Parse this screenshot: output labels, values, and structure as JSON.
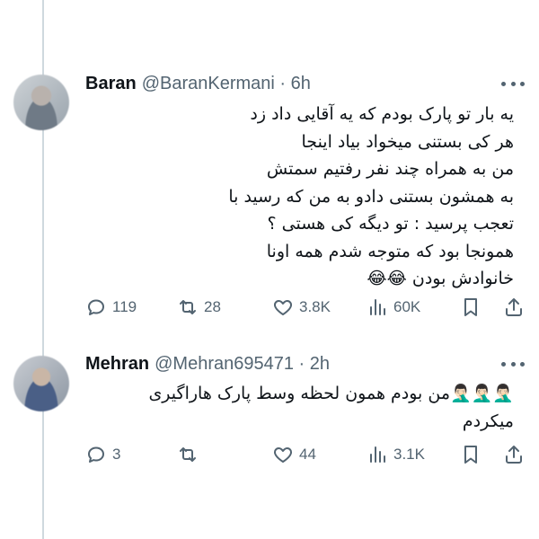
{
  "tweets": [
    {
      "name": "Baran",
      "handle": "@BaranKermani · 6h",
      "text": "یه بار تو پارک بودم که یه آقایی داد زد\nهر کی بستنی میخواد بیاد اینجا\nمن به همراه چند نفر رفتیم سمتش\nبه همشون بستنی دادو به من که رسید با\nتعجب پرسید : تو دیگه کی هستی ؟\nهمونجا بود که متوجه شدم همه اونا\nخانوادش بودن  😂😂",
      "replies": "119",
      "retweets": "28",
      "likes": "3.8K",
      "views": "60K"
    },
    {
      "name": "Mehran",
      "handle": "@Mehran695471 · 2h",
      "text": "🤦🏻‍♂️🤦🏻‍♂️🤦🏻‍♂️من بودم همون لحظه وسط پارک هاراگیری\nمیکردم",
      "replies": "3",
      "retweets": "",
      "likes": "44",
      "views": "3.1K"
    }
  ],
  "icons": [
    "reply-icon",
    "retweet-icon",
    "like-icon",
    "views-icon",
    "bookmark-icon",
    "share-icon",
    "more-icon"
  ]
}
